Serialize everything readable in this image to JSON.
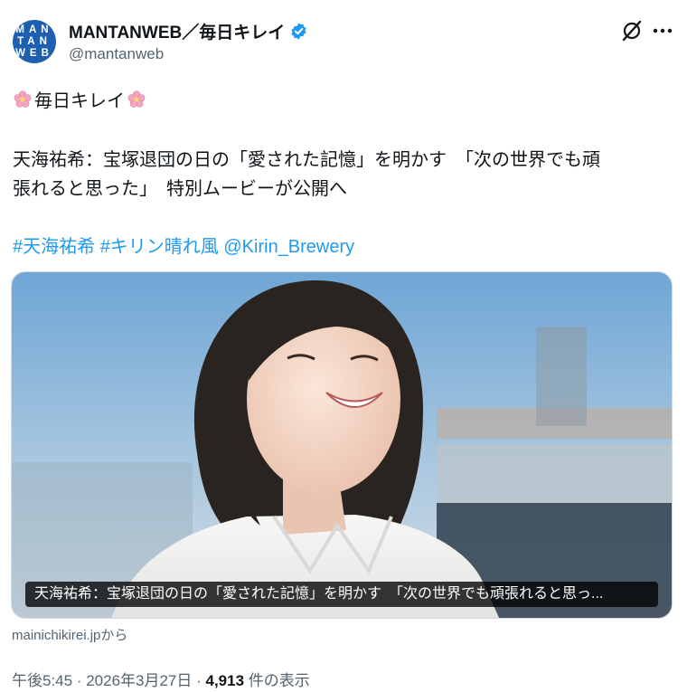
{
  "author": {
    "avatar_lines": [
      "MAN",
      "TAN",
      "WEB"
    ],
    "display_name": "MANTANWEB／毎日キレイ",
    "handle": "@mantanweb",
    "verified": true,
    "verified_icon": "verified-badge-icon",
    "avatar_color": "#1f5fb0"
  },
  "header_actions": {
    "grok_icon": "grok-icon",
    "more_icon": "more-icon"
  },
  "post": {
    "line1_text": "毎日キレイ",
    "line2": "天海祐希：宝塚退団の日の「愛された記憶」を明かす　「次の世界でも頑",
    "line3": "張れると思った」　特別ムービーが公開へ",
    "hashtags": [
      "#天海祐希",
      "#キリン晴れ風",
      "@Kirin_Brewery"
    ],
    "link_color": "#1d9bf0"
  },
  "card": {
    "caption": "天海祐希：宝塚退団の日の「愛された記憶」を明かす　「次の世界でも頑張れると思っ...",
    "source": "mainichikirei.jpから"
  },
  "meta": {
    "time": "午後5:45",
    "sep1": " · ",
    "date": "2026年3月27日",
    "sep2": " · ",
    "views": "4,913",
    "views_suffix": " 件の表示"
  }
}
